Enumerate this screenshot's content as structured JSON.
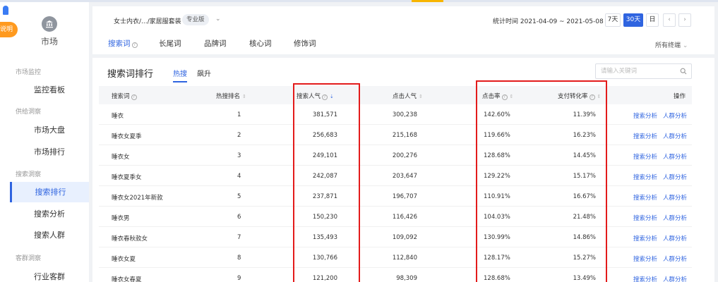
{
  "colors": {
    "accent": "#2f64e0",
    "highlight_box": "#e31b1b",
    "explain_tab": "#ff9a1f"
  },
  "explain_label": "说明",
  "sidebar": {
    "title": "市场",
    "icon": "bank-icon",
    "groups": [
      {
        "label": "市场监控",
        "items": [
          {
            "label": "监控看板"
          }
        ]
      },
      {
        "label": "供给洞察",
        "items": [
          {
            "label": "市场大盘"
          },
          {
            "label": "市场排行"
          }
        ]
      },
      {
        "label": "搜索洞察",
        "items": [
          {
            "label": "搜索排行",
            "active": true
          },
          {
            "label": "搜索分析"
          },
          {
            "label": "搜索人群"
          }
        ]
      },
      {
        "label": "客群洞察",
        "items": [
          {
            "label": "行业客群"
          }
        ]
      }
    ]
  },
  "header": {
    "category_path": "女士内衣/.../家居服套装",
    "edition_badge": "专业版",
    "stat_time": "统计时间 2021-04-09 ~ 2021-05-08",
    "date_buttons": [
      "7天",
      "30天",
      "日"
    ],
    "date_active": "30天",
    "tabs": [
      "搜索词",
      "长尾词",
      "品牌词",
      "核心词",
      "修饰词"
    ],
    "tab_active": "搜索词",
    "terminal_select": "所有终端"
  },
  "content": {
    "title": "搜索词排行",
    "subtabs": [
      "热搜",
      "飙升"
    ],
    "subtab_active": "热搜",
    "search_placeholder": "请输入关键词",
    "columns": [
      "搜索词",
      "热搜排名",
      "搜索人气",
      "点击人气",
      "点击率",
      "支付转化率",
      "操作"
    ],
    "rows": [
      {
        "term": "睡衣",
        "rank": "1",
        "search_pop": "381,571",
        "click_pop": "300,238",
        "ctr": "142.60%",
        "conv": "11.39%"
      },
      {
        "term": "睡衣女夏季",
        "rank": "2",
        "search_pop": "256,683",
        "click_pop": "215,168",
        "ctr": "119.66%",
        "conv": "16.23%"
      },
      {
        "term": "睡衣女",
        "rank": "3",
        "search_pop": "249,101",
        "click_pop": "200,276",
        "ctr": "128.68%",
        "conv": "14.45%"
      },
      {
        "term": "睡衣夏季女",
        "rank": "4",
        "search_pop": "242,087",
        "click_pop": "203,647",
        "ctr": "129.22%",
        "conv": "15.17%"
      },
      {
        "term": "睡衣女2021年新款",
        "rank": "5",
        "search_pop": "237,871",
        "click_pop": "196,707",
        "ctr": "110.91%",
        "conv": "16.67%"
      },
      {
        "term": "睡衣男",
        "rank": "6",
        "search_pop": "150,230",
        "click_pop": "116,426",
        "ctr": "104.03%",
        "conv": "21.48%"
      },
      {
        "term": "睡衣春秋款女",
        "rank": "7",
        "search_pop": "135,493",
        "click_pop": "109,092",
        "ctr": "130.99%",
        "conv": "14.86%"
      },
      {
        "term": "睡衣女夏",
        "rank": "8",
        "search_pop": "130,766",
        "click_pop": "112,840",
        "ctr": "128.17%",
        "conv": "15.27%"
      },
      {
        "term": "睡衣女春夏",
        "rank": "9",
        "search_pop": "121,200",
        "click_pop": "98,309",
        "ctr": "128.68%",
        "conv": "13.49%"
      }
    ],
    "actions": [
      "搜索分析",
      "人群分析"
    ]
  }
}
